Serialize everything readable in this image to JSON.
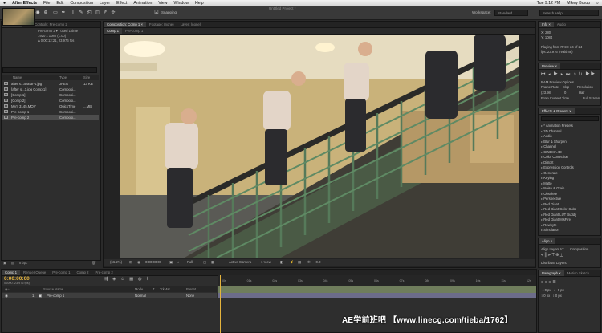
{
  "menubar": {
    "apple": "",
    "app_name": "After Effects",
    "items": [
      "File",
      "Edit",
      "Composition",
      "Layer",
      "Effect",
      "Animation",
      "View",
      "Window",
      "Help"
    ],
    "clock": "Tue 9:12 PM",
    "user": "Mikey Borup"
  },
  "window_title": "Untitled Project *",
  "toolbar": {
    "snapping_label": "Snapping",
    "workspace_label": "Workspace:",
    "workspace_value": "Standard",
    "search_placeholder": "Search Help"
  },
  "project_panel": {
    "tabs": [
      "Project ×",
      "Effect Controls: Pre-comp 2"
    ],
    "info_title": "Pre-comp 2 ▾ , used 1 time",
    "info_size": "1920 x 1080 (1.00)",
    "info_duration": "Δ 0:00:12:21, 23.976 fps",
    "columns": [
      "Name",
      "Type",
      "Size"
    ],
    "rows": [
      {
        "name": "after s...avatar-1.jpg",
        "type": "JPEG",
        "size": "13 KB"
      },
      {
        "name": "[after s...1.jpg Comp 1]",
        "type": "Composi...",
        "size": ""
      },
      {
        "name": "[Comp 1]",
        "type": "Composi...",
        "size": ""
      },
      {
        "name": "[Comp 2]",
        "type": "Composi...",
        "size": ""
      },
      {
        "name": "MVI_3145.MOV",
        "type": "QuickTime",
        "size": "...MB"
      },
      {
        "name": "Pre-comp 1",
        "type": "Composi...",
        "size": ""
      },
      {
        "name": "Pre-comp 2",
        "type": "Composi...",
        "size": ""
      }
    ],
    "footer_bpc": "8 bpc"
  },
  "comp_panel": {
    "tabs": [
      "Composition: Comp 1 ×",
      "Footage: (none)",
      "Layer: (none)"
    ],
    "subtabs": [
      "Comp 1",
      "Pre-comp 1"
    ],
    "bottom_bar": {
      "zoom": "(66.2%)",
      "timecode": "0:00:00:00",
      "resolution": "Full",
      "view": "Active Camera",
      "views": "1 View",
      "exposure": "+0.0"
    }
  },
  "info_panel": {
    "tabs": [
      "Info ×",
      "Audio"
    ],
    "lines": [
      "X: 280",
      "Y: 1084",
      "Playing from RAM: 24 of 24",
      "fps: 23.976 (realtime)"
    ]
  },
  "preview_panel": {
    "title": "Preview ×",
    "ram_options": "RAM Preview Options",
    "frame_rate_label": "Frame Rate",
    "skip_label": "Skip",
    "resolution_label": "Resolution",
    "frame_rate_value": "(23.98)",
    "skip_value": "0",
    "resolution_value": "Half",
    "from_current": "From Current Time",
    "full_screen": "Full Screen"
  },
  "effects_panel": {
    "title": "Effects & Presets ×",
    "items": [
      "* Animation Presets",
      "3D Channel",
      "Audio",
      "Blur & Sharpen",
      "Channel",
      "CINEMA 4D",
      "Color Correction",
      "Distort",
      "Expression Controls",
      "Generate",
      "Keying",
      "Matte",
      "Noise & Grain",
      "Obsolete",
      "Perspective",
      "Red Giant",
      "Red Giant Color Suite",
      "Red Giant LUT Buddy",
      "Red Giant MisFire",
      "Rowbyte",
      "Simulation"
    ]
  },
  "align_panel": {
    "title": "Align ×",
    "align_layers_to": "Align Layers to:",
    "align_value": "Composition",
    "distribute": "Distribute Layers:"
  },
  "paragraph_panel": {
    "tabs": [
      "Paragraph ×",
      "Motion Sketch"
    ]
  },
  "timeline": {
    "tabs": [
      "Comp 1",
      "Render Queue",
      "Pre-comp 1",
      "Comp 2",
      "Pre-comp 2"
    ],
    "timecode": "0:00:00:00",
    "fps_note": "00000 (23.976 fps)",
    "columns": [
      "Source Name",
      "Mode",
      "T",
      "TrkMat",
      "Parent"
    ],
    "layer": {
      "index": "1",
      "name": "Pre-comp 1",
      "mode": "Normal",
      "parent": "None"
    },
    "ruler_ticks": [
      "00s",
      "01s",
      "02s",
      "03s",
      "04s",
      "05s",
      "06s",
      "07s",
      "08s",
      "09s",
      "10s",
      "11s",
      "12s"
    ]
  },
  "watermark": "AE学前班吧 【www.linecg.com/tieba/1762】",
  "colors": {
    "accent_timecode": "#e5b43d",
    "layer_bar": "#6f7d5c",
    "selection": "#4d4d4d"
  }
}
